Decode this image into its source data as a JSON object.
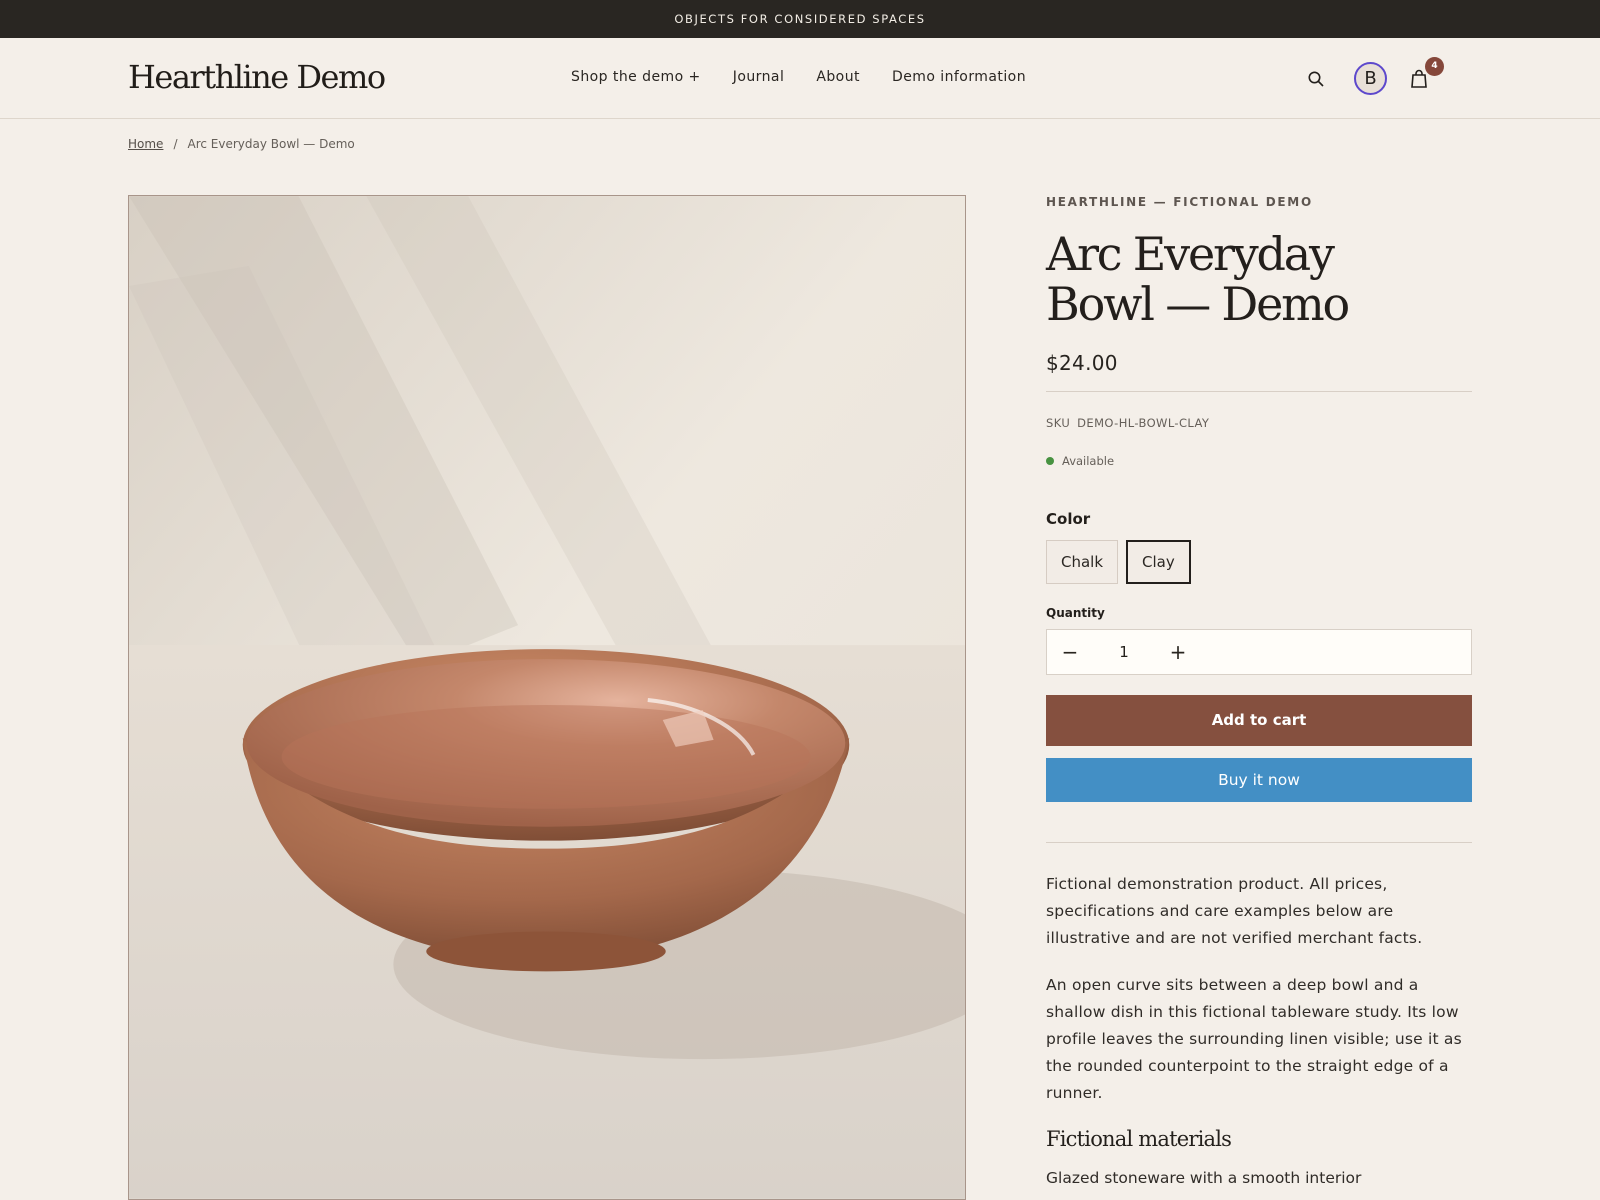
{
  "announcement": "OBJECTS FOR CONSIDERED SPACES",
  "header": {
    "logo": "Hearthline Demo",
    "nav": [
      {
        "label": "Shop the demo +"
      },
      {
        "label": "Journal"
      },
      {
        "label": "About"
      },
      {
        "label": "Demo information"
      }
    ],
    "avatar_initial": "B",
    "cart_count": "4"
  },
  "breadcrumb": {
    "home": "Home",
    "separator": "/",
    "current": "Arc Everyday Bowl — Demo"
  },
  "product": {
    "vendor": "HEARTHLINE — FICTIONAL DEMO",
    "title_line_1": "Arc Everyday",
    "title_line_2": "Bowl — Demo",
    "price": "$24.00",
    "sku_label": "SKU",
    "sku": "DEMO-HL-BOWL-CLAY",
    "availability": "Available",
    "color_label": "Color",
    "color_options": [
      "Chalk",
      "Clay"
    ],
    "selected_color": "Clay",
    "quantity_label": "Quantity",
    "quantity": "1",
    "add_to_cart": "Add to cart",
    "buy_now": "Buy it now",
    "description": [
      "Fictional demonstration product. All prices, specifications and care examples below are illustrative and are not verified merchant facts.",
      "An open curve sits between a deep bowl and a shallow dish in this fictional tableware study. Its low profile leaves the surrounding linen visible; use it as the rounded counterpoint to the straight edge of a runner."
    ],
    "materials_title": "Fictional materials",
    "materials_text": "Glazed stoneware with a smooth interior"
  },
  "icons": {
    "search": "search-icon",
    "cart": "shopping-bag-icon",
    "minus": "minus-icon",
    "plus": "plus-icon"
  },
  "colors": {
    "announcement": "#292622",
    "background": "#f4efe9",
    "add_to_cart": "#85503f",
    "buy_now": "#438fc5",
    "available": "#479241",
    "avatar_ring": "#5d48cc"
  }
}
